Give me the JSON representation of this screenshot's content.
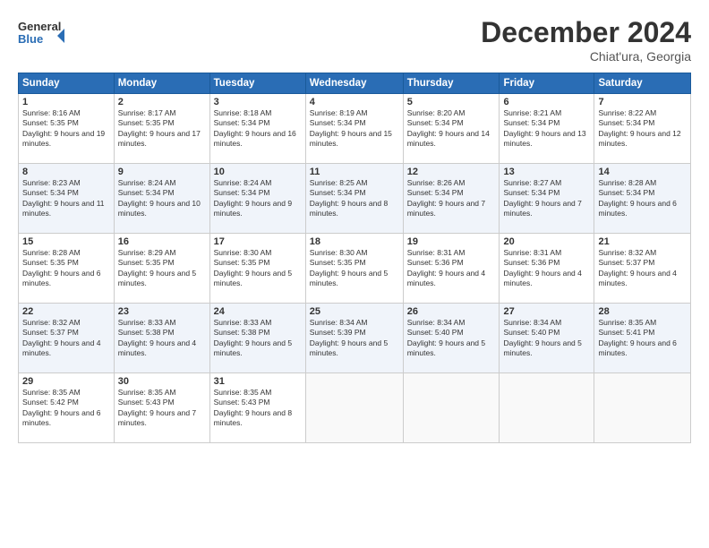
{
  "logo": {
    "text_general": "General",
    "text_blue": "Blue"
  },
  "header": {
    "month": "December 2024",
    "location": "Chiat'ura, Georgia"
  },
  "days_of_week": [
    "Sunday",
    "Monday",
    "Tuesday",
    "Wednesday",
    "Thursday",
    "Friday",
    "Saturday"
  ],
  "weeks": [
    [
      {
        "day": "1",
        "sunrise": "8:16 AM",
        "sunset": "5:35 PM",
        "daylight": "9 hours and 19 minutes."
      },
      {
        "day": "2",
        "sunrise": "8:17 AM",
        "sunset": "5:35 PM",
        "daylight": "9 hours and 17 minutes."
      },
      {
        "day": "3",
        "sunrise": "8:18 AM",
        "sunset": "5:34 PM",
        "daylight": "9 hours and 16 minutes."
      },
      {
        "day": "4",
        "sunrise": "8:19 AM",
        "sunset": "5:34 PM",
        "daylight": "9 hours and 15 minutes."
      },
      {
        "day": "5",
        "sunrise": "8:20 AM",
        "sunset": "5:34 PM",
        "daylight": "9 hours and 14 minutes."
      },
      {
        "day": "6",
        "sunrise": "8:21 AM",
        "sunset": "5:34 PM",
        "daylight": "9 hours and 13 minutes."
      },
      {
        "day": "7",
        "sunrise": "8:22 AM",
        "sunset": "5:34 PM",
        "daylight": "9 hours and 12 minutes."
      }
    ],
    [
      {
        "day": "8",
        "sunrise": "8:23 AM",
        "sunset": "5:34 PM",
        "daylight": "9 hours and 11 minutes."
      },
      {
        "day": "9",
        "sunrise": "8:24 AM",
        "sunset": "5:34 PM",
        "daylight": "9 hours and 10 minutes."
      },
      {
        "day": "10",
        "sunrise": "8:24 AM",
        "sunset": "5:34 PM",
        "daylight": "9 hours and 9 minutes."
      },
      {
        "day": "11",
        "sunrise": "8:25 AM",
        "sunset": "5:34 PM",
        "daylight": "9 hours and 8 minutes."
      },
      {
        "day": "12",
        "sunrise": "8:26 AM",
        "sunset": "5:34 PM",
        "daylight": "9 hours and 7 minutes."
      },
      {
        "day": "13",
        "sunrise": "8:27 AM",
        "sunset": "5:34 PM",
        "daylight": "9 hours and 7 minutes."
      },
      {
        "day": "14",
        "sunrise": "8:28 AM",
        "sunset": "5:34 PM",
        "daylight": "9 hours and 6 minutes."
      }
    ],
    [
      {
        "day": "15",
        "sunrise": "8:28 AM",
        "sunset": "5:35 PM",
        "daylight": "9 hours and 6 minutes."
      },
      {
        "day": "16",
        "sunrise": "8:29 AM",
        "sunset": "5:35 PM",
        "daylight": "9 hours and 5 minutes."
      },
      {
        "day": "17",
        "sunrise": "8:30 AM",
        "sunset": "5:35 PM",
        "daylight": "9 hours and 5 minutes."
      },
      {
        "day": "18",
        "sunrise": "8:30 AM",
        "sunset": "5:35 PM",
        "daylight": "9 hours and 5 minutes."
      },
      {
        "day": "19",
        "sunrise": "8:31 AM",
        "sunset": "5:36 PM",
        "daylight": "9 hours and 4 minutes."
      },
      {
        "day": "20",
        "sunrise": "8:31 AM",
        "sunset": "5:36 PM",
        "daylight": "9 hours and 4 minutes."
      },
      {
        "day": "21",
        "sunrise": "8:32 AM",
        "sunset": "5:37 PM",
        "daylight": "9 hours and 4 minutes."
      }
    ],
    [
      {
        "day": "22",
        "sunrise": "8:32 AM",
        "sunset": "5:37 PM",
        "daylight": "9 hours and 4 minutes."
      },
      {
        "day": "23",
        "sunrise": "8:33 AM",
        "sunset": "5:38 PM",
        "daylight": "9 hours and 4 minutes."
      },
      {
        "day": "24",
        "sunrise": "8:33 AM",
        "sunset": "5:38 PM",
        "daylight": "9 hours and 5 minutes."
      },
      {
        "day": "25",
        "sunrise": "8:34 AM",
        "sunset": "5:39 PM",
        "daylight": "9 hours and 5 minutes."
      },
      {
        "day": "26",
        "sunrise": "8:34 AM",
        "sunset": "5:40 PM",
        "daylight": "9 hours and 5 minutes."
      },
      {
        "day": "27",
        "sunrise": "8:34 AM",
        "sunset": "5:40 PM",
        "daylight": "9 hours and 5 minutes."
      },
      {
        "day": "28",
        "sunrise": "8:35 AM",
        "sunset": "5:41 PM",
        "daylight": "9 hours and 6 minutes."
      }
    ],
    [
      {
        "day": "29",
        "sunrise": "8:35 AM",
        "sunset": "5:42 PM",
        "daylight": "9 hours and 6 minutes."
      },
      {
        "day": "30",
        "sunrise": "8:35 AM",
        "sunset": "5:43 PM",
        "daylight": "9 hours and 7 minutes."
      },
      {
        "day": "31",
        "sunrise": "8:35 AM",
        "sunset": "5:43 PM",
        "daylight": "9 hours and 8 minutes."
      },
      null,
      null,
      null,
      null
    ]
  ],
  "labels": {
    "sunrise": "Sunrise:",
    "sunset": "Sunset:",
    "daylight": "Daylight:"
  }
}
